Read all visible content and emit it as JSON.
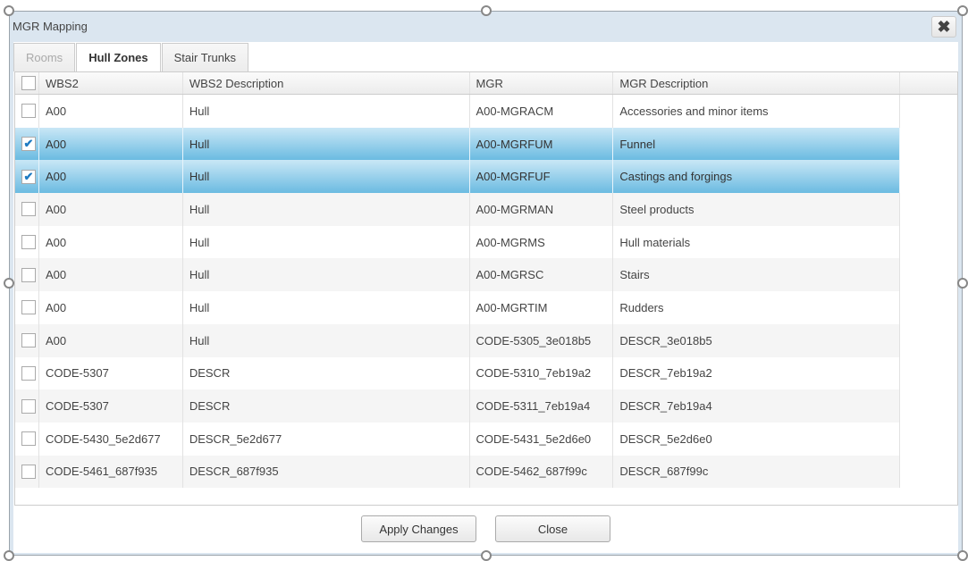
{
  "dialog": {
    "title": "MGR Mapping",
    "close_icon": "close-icon"
  },
  "tabs": [
    {
      "label": "Rooms",
      "state": "disabled"
    },
    {
      "label": "Hull Zones",
      "state": "active"
    },
    {
      "label": "Stair Trunks",
      "state": "normal"
    }
  ],
  "grid": {
    "columns": [
      "WBS2",
      "WBS2 Description",
      "MGR",
      "MGR Description"
    ],
    "rows": [
      {
        "checked": false,
        "wbs2": "A00",
        "wbs2_desc": "Hull",
        "mgr": "A00-MGRACM",
        "mgr_desc": "Accessories and minor items"
      },
      {
        "checked": true,
        "wbs2": "A00",
        "wbs2_desc": "Hull",
        "mgr": "A00-MGRFUM",
        "mgr_desc": "Funnel"
      },
      {
        "checked": true,
        "wbs2": "A00",
        "wbs2_desc": "Hull",
        "mgr": "A00-MGRFUF",
        "mgr_desc": "Castings and forgings"
      },
      {
        "checked": false,
        "wbs2": "A00",
        "wbs2_desc": "Hull",
        "mgr": "A00-MGRMAN",
        "mgr_desc": "Steel products"
      },
      {
        "checked": false,
        "wbs2": "A00",
        "wbs2_desc": "Hull",
        "mgr": "A00-MGRMS",
        "mgr_desc": "Hull materials"
      },
      {
        "checked": false,
        "wbs2": "A00",
        "wbs2_desc": "Hull",
        "mgr": "A00-MGRSC",
        "mgr_desc": "Stairs"
      },
      {
        "checked": false,
        "wbs2": "A00",
        "wbs2_desc": "Hull",
        "mgr": "A00-MGRTIM",
        "mgr_desc": "Rudders"
      },
      {
        "checked": false,
        "wbs2": "A00",
        "wbs2_desc": "Hull",
        "mgr": "CODE-5305_3e018b5",
        "mgr_desc": "DESCR_3e018b5"
      },
      {
        "checked": false,
        "wbs2": "CODE-5307",
        "wbs2_desc": "DESCR",
        "mgr": "CODE-5310_7eb19a2",
        "mgr_desc": "DESCR_7eb19a2"
      },
      {
        "checked": false,
        "wbs2": "CODE-5307",
        "wbs2_desc": "DESCR",
        "mgr": "CODE-5311_7eb19a4",
        "mgr_desc": "DESCR_7eb19a4"
      },
      {
        "checked": false,
        "wbs2": "CODE-5430_5e2d677",
        "wbs2_desc": "DESCR_5e2d677",
        "mgr": "CODE-5431_5e2d6e0",
        "mgr_desc": "DESCR_5e2d6e0"
      },
      {
        "checked": false,
        "wbs2": "CODE-5461_687f935",
        "wbs2_desc": "DESCR_687f935",
        "mgr": "CODE-5462_687f99c",
        "mgr_desc": "DESCR_687f99c"
      }
    ]
  },
  "buttons": {
    "apply": "Apply Changes",
    "close": "Close"
  }
}
